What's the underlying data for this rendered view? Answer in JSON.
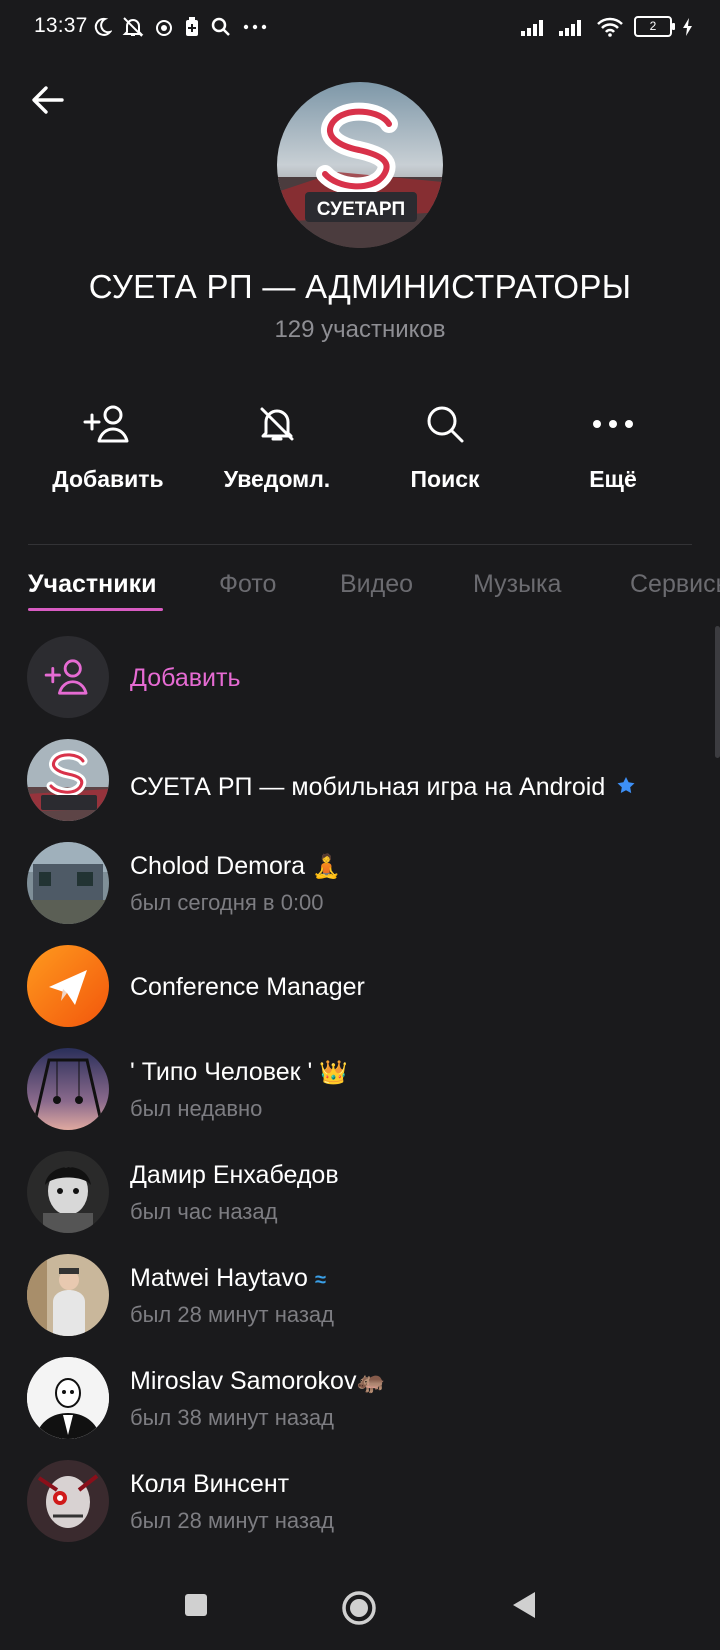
{
  "status_bar": {
    "time": "13:37",
    "battery": "2",
    "icons": [
      "moon-icon",
      "bell-off-icon",
      "app-icon",
      "battery-saver-icon",
      "search-icon",
      "more-icon",
      "signal-icon",
      "signal-icon",
      "wifi-icon",
      "battery-icon",
      "charging-icon"
    ]
  },
  "header": {
    "title": "СУЕТА РП — АДМИНИСТРАТОРЫ",
    "subtitle": "129 участников",
    "avatar_text": "СУЕТАРП"
  },
  "actions": [
    {
      "label": "Добавить",
      "icon": "add-user-icon"
    },
    {
      "label": "Уведомл.",
      "icon": "bell-off-icon"
    },
    {
      "label": "Поиск",
      "icon": "search-icon"
    },
    {
      "label": "Ещё",
      "icon": "more-icon"
    }
  ],
  "tabs": [
    "Участники",
    "Фото",
    "Видео",
    "Музыка",
    "Сервисы"
  ],
  "active_tab": "Участники",
  "add_member": {
    "label": "Добавить"
  },
  "members": [
    {
      "name": "СУЕТА РП — мобильная игра на Android",
      "status": "",
      "badge": "verified-star"
    },
    {
      "name": "Cholod Demora",
      "status": "был сегодня в 0:00",
      "badge": "meditation-emoji"
    },
    {
      "name": "Conference Manager",
      "status": "",
      "badge": ""
    },
    {
      "name": "' Типо Человек '",
      "status": "был недавно",
      "badge": "crown-emoji"
    },
    {
      "name": "Дамир Енхабедов",
      "status": "был час назад",
      "badge": ""
    },
    {
      "name": "Matwei Haytavo",
      "status": "был 28 минут назад",
      "badge": "zenit-logo"
    },
    {
      "name": "Miroslav Samorokov",
      "status": "был 38 минут назад",
      "badge": "hippo-emoji"
    },
    {
      "name": "Коля Винсент",
      "status": "был 28 минут назад",
      "badge": ""
    }
  ],
  "colors": {
    "background": "#1a1a1c",
    "accent": "#e66bd3",
    "muted": "#8e8e93",
    "verified": "#3d8ff5"
  }
}
